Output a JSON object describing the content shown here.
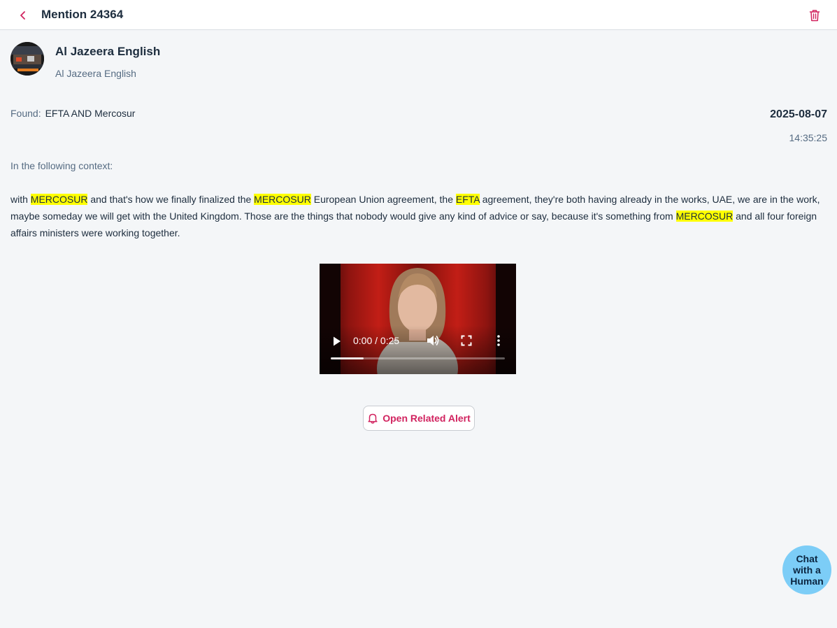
{
  "header": {
    "title": "Mention 24364",
    "back_icon": "chevron-left-icon",
    "delete_icon": "trash-icon"
  },
  "source": {
    "name": "Al Jazeera English",
    "subtitle": "Al Jazeera English"
  },
  "found": {
    "label": "Found:",
    "value": "EFTA AND Mercosur"
  },
  "timestamp": {
    "date": "2025-08-07",
    "time": "14:35:25"
  },
  "context": {
    "label": "In the following context:",
    "segments": [
      {
        "text": "with ",
        "highlight": false
      },
      {
        "text": "MERCOSUR",
        "highlight": true
      },
      {
        "text": " and that's how we finally finalized the ",
        "highlight": false
      },
      {
        "text": "MERCOSUR",
        "highlight": true
      },
      {
        "text": " European Union agreement, the ",
        "highlight": false
      },
      {
        "text": "EFTA",
        "highlight": true
      },
      {
        "text": " agreement, they're both having already in the works, UAE, we are in the work, maybe someday we will get with the United Kingdom. Those are the things that nobody would give any kind of advice or say, because it's something from ",
        "highlight": false
      },
      {
        "text": "MERCOSUR",
        "highlight": true
      },
      {
        "text": " and all four foreign affairs ministers were working together.",
        "highlight": false
      }
    ]
  },
  "video": {
    "time_display": "0:00 / 0:25",
    "progress_fraction": 0.19
  },
  "actions": {
    "open_alert_label": "Open Related Alert",
    "open_alert_icon": "bell-icon"
  },
  "chat": {
    "label_lines": [
      "Chat",
      "with a",
      "Human"
    ]
  },
  "colors": {
    "accent": "#d1235f",
    "highlight": "#ffff00",
    "chat_bubble": "#7ccdf7"
  }
}
